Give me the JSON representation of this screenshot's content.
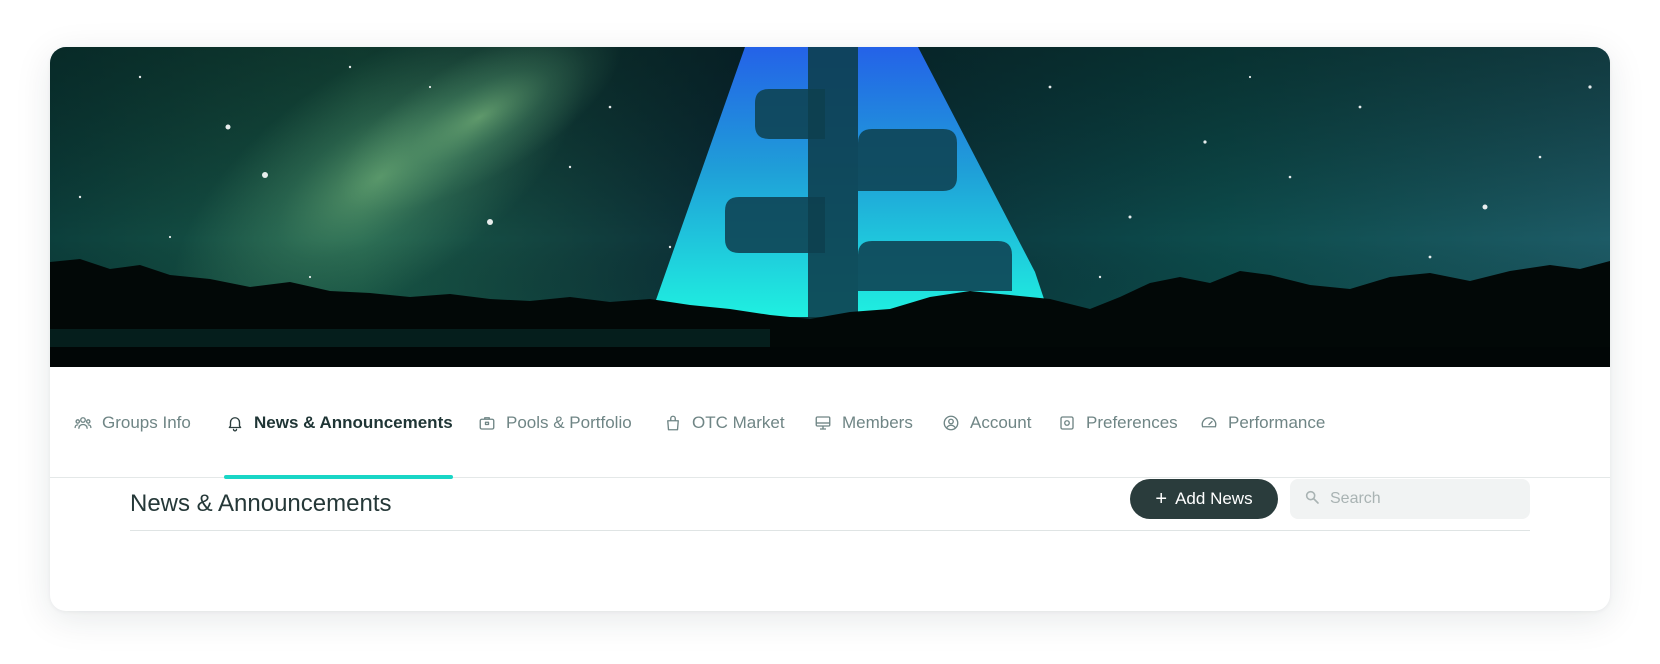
{
  "tabs": [
    {
      "label": "Groups Info",
      "icon": "users-icon"
    },
    {
      "label": "News & Announcements",
      "icon": "bell-icon",
      "active": true
    },
    {
      "label": "Pools & Portfolio",
      "icon": "briefcase-icon"
    },
    {
      "label": "OTC Market",
      "icon": "shopping-bag-icon"
    },
    {
      "label": "Members",
      "icon": "monitor-icon"
    },
    {
      "label": "Account",
      "icon": "user-circle-icon"
    },
    {
      "label": "Preferences",
      "icon": "settings-square-icon"
    },
    {
      "label": "Performance",
      "icon": "speedometer-icon"
    }
  ],
  "main": {
    "title": "News & Announcements",
    "add_button_label": "Add News",
    "search_placeholder": "Search"
  },
  "colors": {
    "accent": "#19d6c6",
    "button_bg": "#2a3c3c",
    "tab_text": "#6f8585",
    "tab_active_text": "#1f3535"
  }
}
